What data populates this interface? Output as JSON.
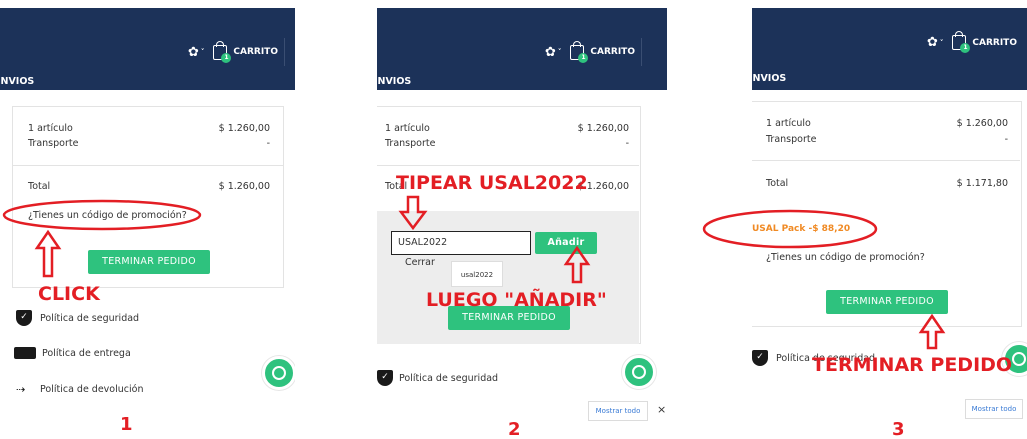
{
  "colors": {
    "header": "#1c3259",
    "accent_green": "#2ec27e",
    "annotation_red": "#e31e24",
    "promo_orange": "#f08a24",
    "link_blue": "#3a7bd5"
  },
  "header": {
    "cart_label": "CARRITO",
    "cart_count": "1",
    "section_title": "ENVIOS"
  },
  "summary": {
    "items_label": "1 artículo",
    "items_value": "$ 1.260,00",
    "shipping_label": "Transporte",
    "shipping_value": "-",
    "total_label": "Total",
    "total_value": "$ 1.260,00",
    "total_value_discounted": "$ 1.171,80"
  },
  "promo": {
    "link_text": "¿Tienes un código de promoción?",
    "input_value": "USAL2022",
    "add_label": "Añadir",
    "close_label": "Cerrar",
    "suggestion": "usal2022",
    "applied": "USAL Pack -$ 88,20"
  },
  "checkout_label": "TERMINAR PEDIDO",
  "policies": [
    "Política de seguridad",
    "Política de entrega",
    "Política de devolución"
  ],
  "show_all_label": "Mostrar todo",
  "close_x": "×",
  "annotations": {
    "click": "CLICK",
    "type": "TIPEAR USAL2022",
    "then_add": "LUEGO \"AÑADIR\"",
    "finish": "TERMINAR PEDIDO"
  },
  "step_numbers": [
    "1",
    "2",
    "3"
  ],
  "icons": [
    "gear-icon",
    "chevron-down-icon",
    "shopping-bag-icon",
    "shield-check-icon",
    "truck-icon",
    "return-arrow-icon",
    "whatsapp-icon"
  ]
}
